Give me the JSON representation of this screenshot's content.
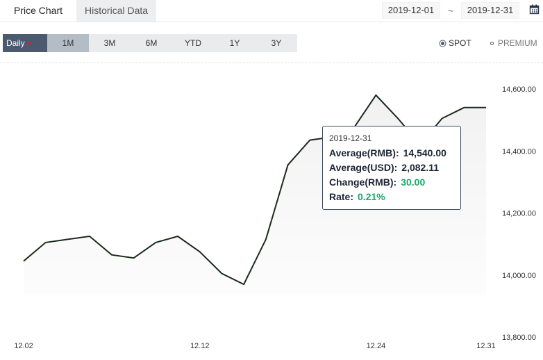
{
  "tabs": [
    {
      "label": "Price Chart",
      "active": true
    },
    {
      "label": "Historical Data",
      "active": false
    }
  ],
  "date_range": {
    "start": "2019-12-01",
    "separator": "~",
    "end": "2019-12-31"
  },
  "periods": {
    "daily": "Daily",
    "items": [
      "1M",
      "3M",
      "6M",
      "YTD",
      "1Y",
      "3Y"
    ],
    "selected": "1M"
  },
  "price_type": {
    "spot": "SPOT",
    "premium": "PREMIUM",
    "selected": "SPOT"
  },
  "tooltip": {
    "date": "2019-12-31",
    "avg_rmb_label": "Average(RMB):",
    "avg_rmb_value": "14,540.00",
    "avg_usd_label": "Average(USD):",
    "avg_usd_value": "2,082.11",
    "change_label": "Change(RMB):",
    "change_value": "30.00",
    "rate_label": "Rate:",
    "rate_value": "0.21%"
  },
  "colors": {
    "line": "#1b2a1b",
    "accent": "#4c5a70",
    "positive": "#1aa86b"
  },
  "chart_data": {
    "type": "line",
    "x": [
      "12.02",
      "12.03",
      "12.04",
      "12.05",
      "12.06",
      "12.09",
      "12.10",
      "12.11",
      "12.12",
      "12.13",
      "12.16",
      "12.17",
      "12.18",
      "12.19",
      "12.20",
      "12.23",
      "12.24",
      "12.25",
      "12.26",
      "12.27",
      "12.30",
      "12.31"
    ],
    "values": [
      14045,
      14105,
      14115,
      14125,
      14065,
      14055,
      14105,
      14125,
      14075,
      14005,
      13970,
      14115,
      14355,
      14435,
      14445,
      14475,
      14580,
      14505,
      14420,
      14505,
      14540,
      14540
    ],
    "xtick_labels": [
      "12.02",
      "12.12",
      "12.24",
      "12.31"
    ],
    "ytick_labels": [
      "14,600.00",
      "14,400.00",
      "14,200.00",
      "14,000.00",
      "13,800.00"
    ],
    "yticks": [
      14600,
      14400,
      14200,
      14000,
      13800
    ],
    "ylim": [
      13800,
      14600
    ],
    "grid": false,
    "area_fill": true
  }
}
